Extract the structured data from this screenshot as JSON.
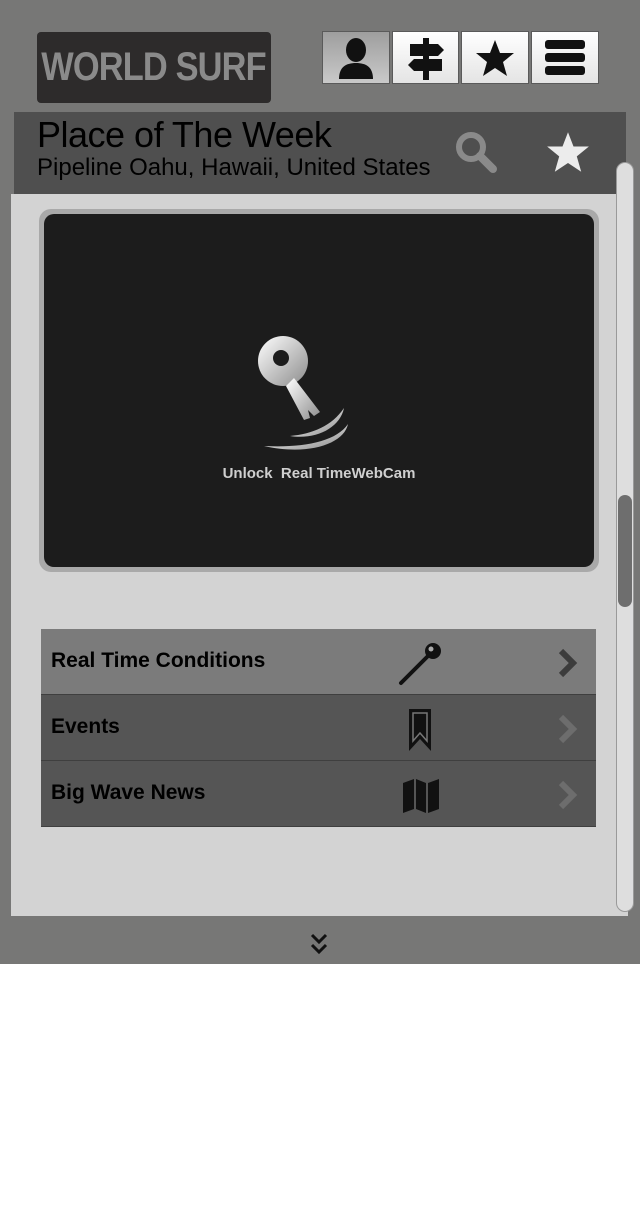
{
  "app": {
    "logo_text": "WORLD SURF"
  },
  "toolbar": {
    "buttons": [
      {
        "icon": "user-icon",
        "active": true
      },
      {
        "icon": "signpost-icon",
        "active": false
      },
      {
        "icon": "star-icon",
        "active": false
      },
      {
        "icon": "menu-icon",
        "active": false
      }
    ]
  },
  "header": {
    "title": "Place of The Week",
    "subtitle": "Pipeline Oahu, Hawaii, United States",
    "search_icon": "search-icon",
    "favorite_icon": "star-icon"
  },
  "webcam": {
    "icon": "key-icon",
    "label": "Unlock  Real TimeWebCam"
  },
  "menu": {
    "items": [
      {
        "label": "Real Time Conditions",
        "icon": "pin-icon"
      },
      {
        "label": "Events",
        "icon": "bookmark-icon"
      },
      {
        "label": "Big Wave News",
        "icon": "map-icon"
      }
    ]
  },
  "footer": {
    "icon": "double-chevron-down-icon"
  },
  "colors": {
    "frame_bg": "#777776",
    "header_bg": "#4f4f4f",
    "panel_bg": "#d3d3d3",
    "webcam_bg": "#1c1c1c",
    "menu_highlight": "#7b7b7b",
    "menu_row": "#555555"
  }
}
